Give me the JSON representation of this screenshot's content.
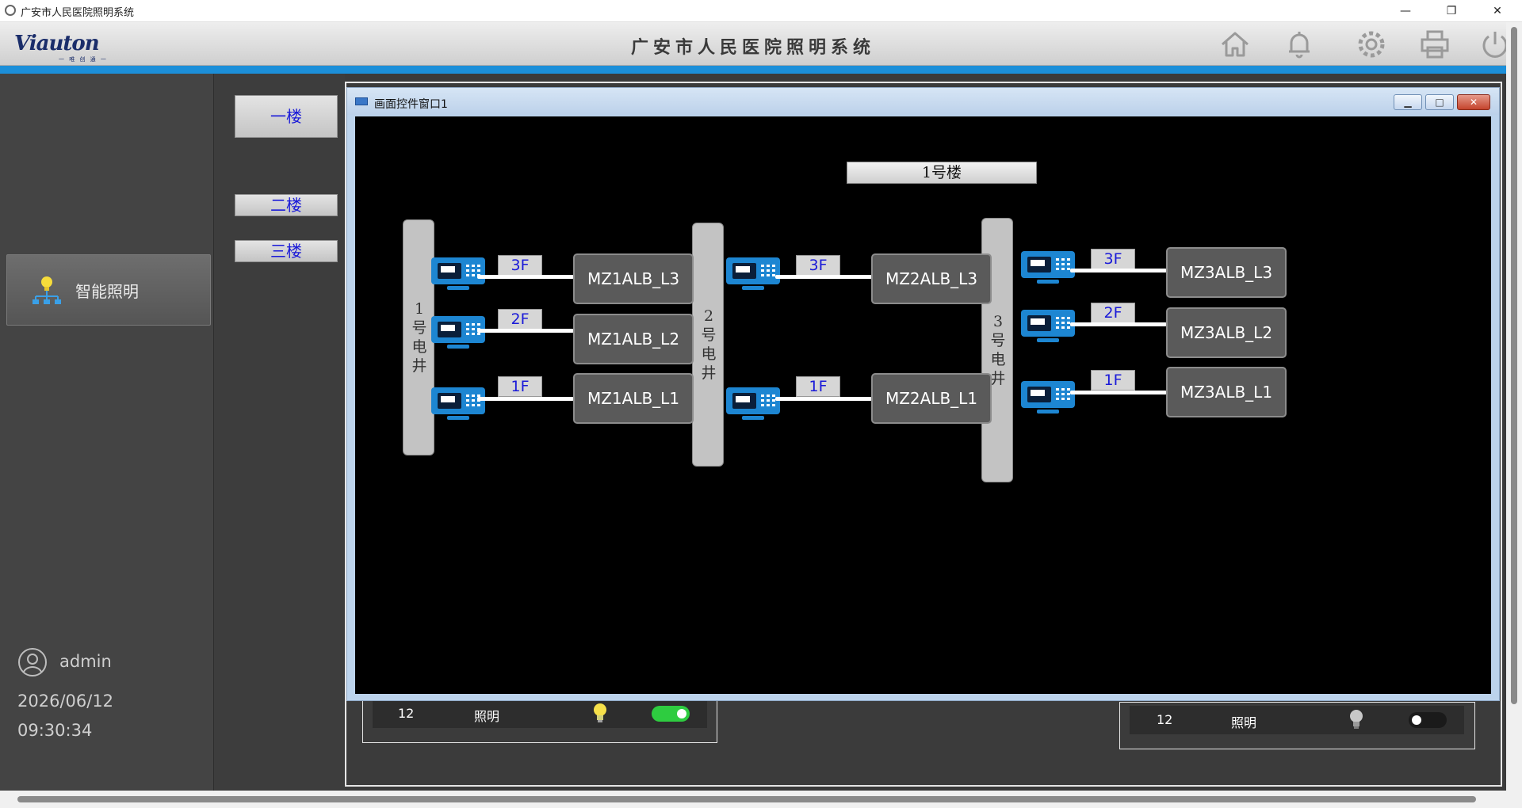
{
  "os_window": {
    "title": "广安市人民医院照明系统",
    "minimize": "—",
    "restore": "❐",
    "close": "✕"
  },
  "header": {
    "logo_text": "Viauton",
    "logo_sub": "一 唯 创 通 一",
    "title": "广安市人民医院照明系统",
    "icons": [
      "home-icon",
      "bell-icon",
      "gear-icon",
      "printer-icon",
      "power-icon"
    ]
  },
  "sidebar": {
    "nav_item": {
      "label": "智能照明",
      "icon": "lightbulb-network-icon"
    },
    "user": "admin",
    "date": "2026/06/12",
    "time": "09:30:34"
  },
  "floors": [
    {
      "label": "一楼"
    },
    {
      "label": "二楼"
    },
    {
      "label": "三楼"
    }
  ],
  "devices": [
    {
      "number": "12",
      "label": "照明",
      "state": "on",
      "toggle_color": "#2ecc40"
    },
    {
      "number": "12",
      "label": "照明",
      "state": "off",
      "toggle_color": "#1a1a1a"
    }
  ],
  "dialog": {
    "title": "画面控件窗口1",
    "building": "1号楼",
    "shafts": [
      {
        "label_lines": [
          "1",
          "号",
          "电",
          "井"
        ]
      },
      {
        "label_lines": [
          "2",
          "号",
          "电",
          "井"
        ]
      },
      {
        "label_lines": [
          "3",
          "号",
          "电",
          "井"
        ]
      }
    ],
    "groups": [
      [
        {
          "floor": "3F",
          "panel": "MZ1ALB_L3"
        },
        {
          "floor": "2F",
          "panel": "MZ1ALB_L2"
        },
        {
          "floor": "1F",
          "panel": "MZ1ALB_L1"
        }
      ],
      [
        {
          "floor": "3F",
          "panel": "MZ2ALB_L3"
        },
        {
          "floor": "1F",
          "panel": "MZ2ALB_L1"
        }
      ],
      [
        {
          "floor": "3F",
          "panel": "MZ3ALB_L3"
        },
        {
          "floor": "2F",
          "panel": "MZ3ALB_L2"
        },
        {
          "floor": "1F",
          "panel": "MZ3ALB_L1"
        }
      ]
    ]
  },
  "colors": {
    "accent_blue": "#1c8fd9",
    "device_blue": "#1d86d2",
    "floor_text": "#1a1ad8"
  }
}
